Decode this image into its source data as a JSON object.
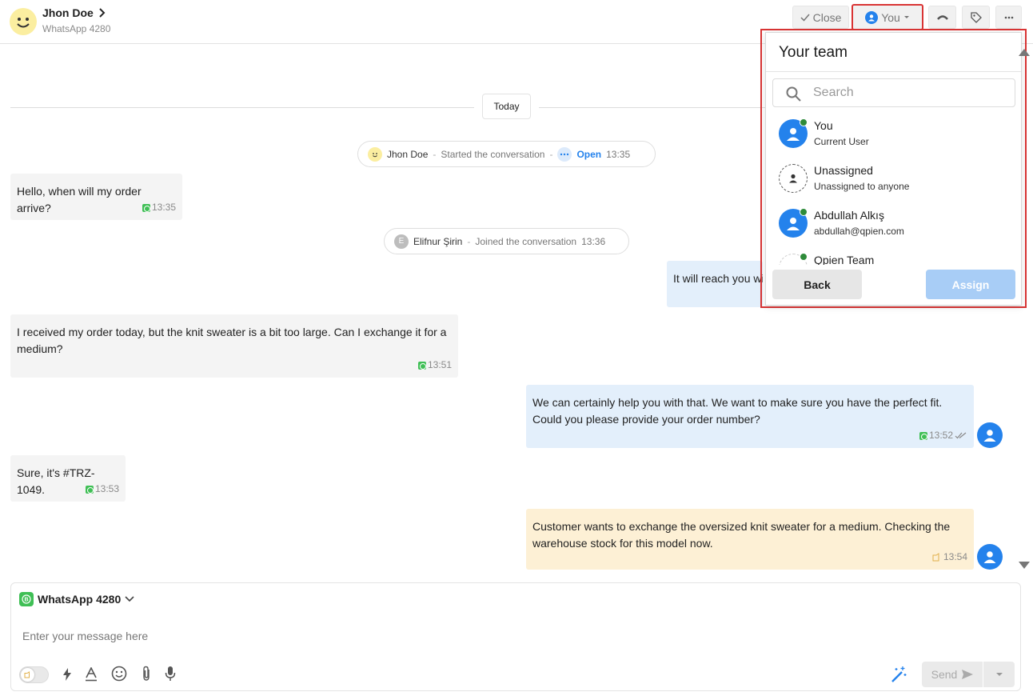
{
  "contact": {
    "name": "Jhon Doe",
    "channel": "WhatsApp 4280"
  },
  "toolbar": {
    "close_label": "Close",
    "assignee_label": "You"
  },
  "conversation": {
    "date_divider": "Today",
    "events": [
      {
        "who": "Jhon Doe",
        "action": "Started the conversation",
        "status": "Open",
        "time": "13:35"
      },
      {
        "who": "Elifnur Şirin",
        "avatar_letter": "E",
        "action": "Joined the conversation",
        "time": "13:36"
      }
    ],
    "messages": [
      {
        "text": "Hello, when will my order arrive?",
        "time": "13:35"
      },
      {
        "text": "It will reach you wi",
        "time": ""
      },
      {
        "text": "I received my order today, but the knit sweater is a bit too large. Can I exchange it for a medium?",
        "time": "13:51"
      },
      {
        "text": "We can certainly help you with that. We want to make sure you have the perfect fit. Could you please provide your order number?",
        "time": "13:52"
      },
      {
        "text": "Sure, it's #TRZ-1049.",
        "time": "13:53"
      },
      {
        "text": "Customer wants to exchange the oversized knit sweater for a medium. Checking the warehouse stock for this model now.",
        "time": "13:54"
      }
    ]
  },
  "team_dropdown": {
    "title": "Your team",
    "search_placeholder": "Search",
    "members": [
      {
        "name": "You",
        "sub": "Current User"
      },
      {
        "name": "Unassigned",
        "sub": "Unassigned to anyone"
      },
      {
        "name": "Abdullah Alkış",
        "sub": "abdullah@qpien.com"
      },
      {
        "name": "Qpien Team",
        "sub": ""
      }
    ],
    "back_label": "Back",
    "assign_label": "Assign"
  },
  "composer": {
    "channel": "WhatsApp 4280",
    "placeholder": "Enter your message here",
    "send_label": "Send"
  },
  "colors": {
    "accent": "#2482ec",
    "online": "#2e8b3a",
    "highlight": "#d93434",
    "note_bg": "#fdf0d5",
    "outgoing_bg": "#e3effb",
    "whatsapp": "#3fbf55"
  }
}
